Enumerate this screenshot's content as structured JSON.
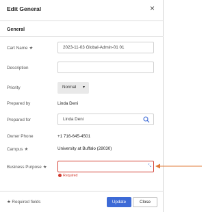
{
  "dialog": {
    "title": "Edit General",
    "close_icon": "×",
    "section": "General"
  },
  "fields": {
    "cart_name": {
      "label": "Cart Name",
      "required_mark": "★",
      "value": "2023-11-03 Global-Admin-01 01"
    },
    "description": {
      "label": "Description",
      "value": ""
    },
    "priority": {
      "label": "Priority",
      "value": "Normal",
      "chevron": "▾"
    },
    "prepared_by": {
      "label": "Prepared by",
      "value": "Linda Deni"
    },
    "prepared_for": {
      "label": "Prepared for",
      "value": "Linda Deni",
      "icon": "search-icon"
    },
    "owner_phone": {
      "label": "Owner Phone",
      "value": "+1 716-645-4501"
    },
    "campus": {
      "label": "Campus",
      "required_mark": "★",
      "value": "University at Buffalo (28030)"
    },
    "business_purpose": {
      "label": "Business Purpose",
      "required_mark": "★",
      "value": "",
      "resize_icon": "⤡",
      "error": "Required"
    }
  },
  "footer": {
    "required_fields": "★ Required fields",
    "update_label": "Update",
    "close_label": "Close"
  },
  "colors": {
    "error": "#d23b2f",
    "primary": "#3d6ad6",
    "annotation_arrow": "#e07b39"
  }
}
